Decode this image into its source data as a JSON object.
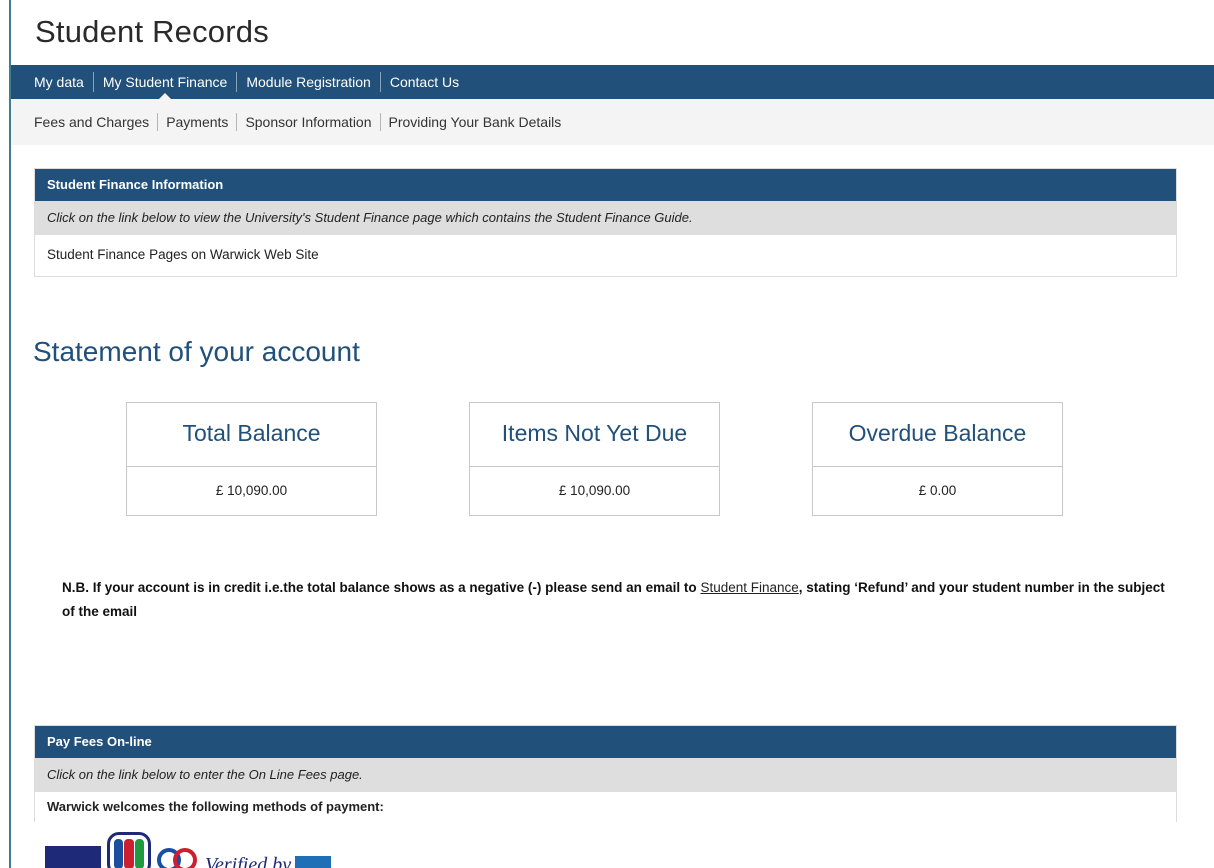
{
  "site": {
    "title": "Student Records"
  },
  "primary_nav": [
    {
      "label": "My data",
      "active": false
    },
    {
      "label": "My Student Finance",
      "active": true
    },
    {
      "label": "Module Registration",
      "active": false
    },
    {
      "label": "Contact Us",
      "active": false
    }
  ],
  "secondary_nav": [
    {
      "label": "Fees and Charges"
    },
    {
      "label": "Payments"
    },
    {
      "label": "Sponsor Information"
    },
    {
      "label": "Providing Your Bank Details"
    }
  ],
  "finance_panel": {
    "header": "Student Finance Information",
    "note": "Click on the link below to view the University's Student Finance page which contains the Student Finance Guide.",
    "link": "Student Finance Pages on Warwick Web Site"
  },
  "statement": {
    "title": "Statement of your account",
    "cards": [
      {
        "title": "Total Balance",
        "value": "£ 10,090.00"
      },
      {
        "title": "Items Not Yet Due",
        "value": "£ 10,090.00"
      },
      {
        "title": "Overdue Balance",
        "value": "£ 0.00"
      }
    ],
    "nb_before": "N.B. If your account is in credit i.e.the total balance shows as a negative (-) please send an email to ",
    "nb_link": "Student Finance",
    "nb_after": ", stating ‘Refund’ and your student number in the subject of the email"
  },
  "pay_panel": {
    "header": "Pay Fees On-line",
    "note": "Click on the link below to enter the On Line Fees page.",
    "methods_text": "Warwick welcomes the following methods of payment:",
    "verified_text": "Verified by"
  },
  "colors": {
    "brand": "#21507a",
    "left_rule": "#3e7f8f",
    "note_bg": "#dedede",
    "subnav_bg": "#f4f4f4"
  },
  "icons": [
    "visa-card-icon",
    "jcb-card-icon",
    "mastercard-icon",
    "verified-by-visa-icon"
  ]
}
